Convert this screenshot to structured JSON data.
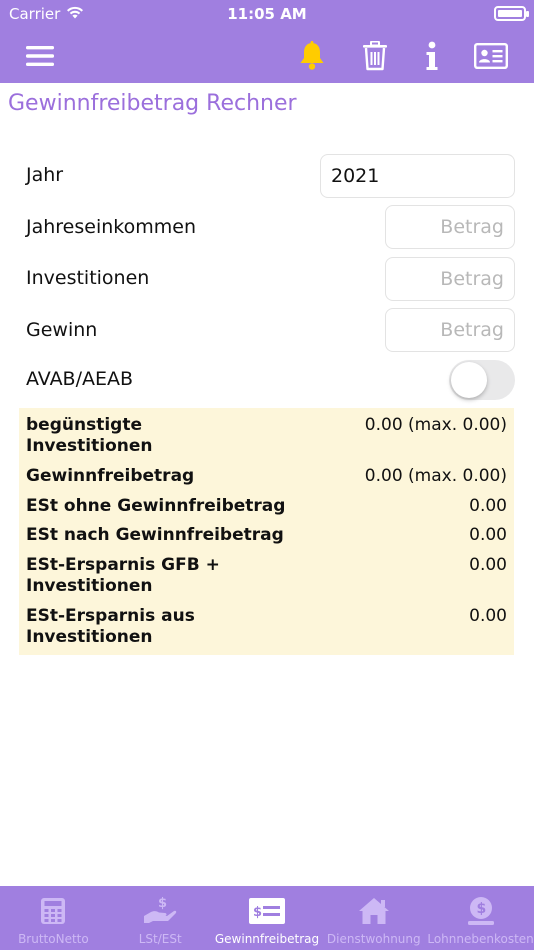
{
  "status": {
    "carrier": "Carrier",
    "time": "11:05 AM"
  },
  "nav": {
    "icons": [
      "menu-icon",
      "bell-icon",
      "trash-icon",
      "info-icon",
      "contact-card-icon"
    ]
  },
  "title": "Gewinnfreibetrag Rechner",
  "form": {
    "year_label": "Jahr",
    "year_value": "2021",
    "income_label": "Jahreseinkommen",
    "income_placeholder": "Betrag",
    "invest_label": "Investitionen",
    "invest_placeholder": "Betrag",
    "profit_label": "Gewinn",
    "profit_placeholder": "Betrag",
    "avab_label": "AVAB/AEAB",
    "avab_on": false
  },
  "results": [
    {
      "label_line1": "begünstigte",
      "label_line2": "Investitionen",
      "value": "0.00 (max. 0.00)"
    },
    {
      "label_line1": "Gewinnfreibetrag",
      "label_line2": "",
      "value": "0.00 (max. 0.00)"
    },
    {
      "label_line1": "ESt ohne Gewinnfreibetrag",
      "label_line2": "",
      "value": "0.00"
    },
    {
      "label_line1": "ESt nach Gewinnfreibetrag",
      "label_line2": "",
      "value": "0.00"
    },
    {
      "label_line1": "ESt-Ersparnis GFB +",
      "label_line2": "Investitionen",
      "value": "0.00"
    },
    {
      "label_line1": "ESt-Ersparnis aus",
      "label_line2": "Investitionen",
      "value": "0.00"
    }
  ],
  "tabs": [
    {
      "label": "BruttoNetto",
      "icon": "calculator-icon"
    },
    {
      "label": "LSt/ESt",
      "icon": "hand-money-icon"
    },
    {
      "label": "Gewinnfreibetrag",
      "icon": "cheque-icon",
      "active": true
    },
    {
      "label": "Dienstwohnung",
      "icon": "house-icon"
    },
    {
      "label": "Lohnnebenkosten",
      "icon": "money-bag-icon"
    }
  ],
  "colors": {
    "accent": "#a07fe0",
    "title": "#9b6fdc",
    "panel": "#fdf6da",
    "bell": "#ffcc00"
  }
}
